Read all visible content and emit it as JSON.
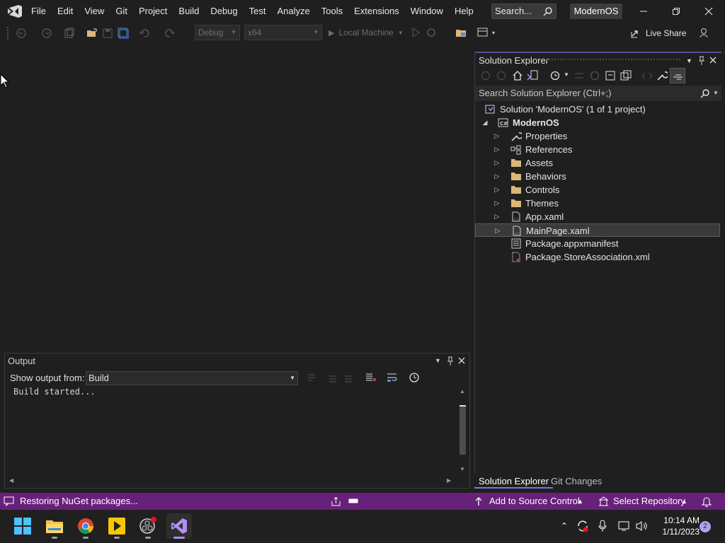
{
  "menu": [
    "File",
    "Edit",
    "View",
    "Git",
    "Project",
    "Build",
    "Debug",
    "Test",
    "Analyze",
    "Tools",
    "Extensions",
    "Window",
    "Help"
  ],
  "search": {
    "placeholder": "Search..."
  },
  "project_name": "ModernOS",
  "toolbar": {
    "config": "Debug",
    "platform": "x64",
    "run_target": "Local Machine",
    "live_share": "Live Share"
  },
  "output": {
    "title": "Output",
    "show_from_label": "Show output from:",
    "source": "Build",
    "text": "Build started..."
  },
  "solution_explorer": {
    "title": "Solution Explorer",
    "search_placeholder": "Search Solution Explorer (Ctrl+;)",
    "solution": "Solution 'ModernOS' (1 of 1 project)",
    "project": "ModernOS",
    "items": [
      {
        "label": "Properties",
        "icon": "wrench-icon"
      },
      {
        "label": "References",
        "icon": "references-icon"
      },
      {
        "label": "Assets",
        "icon": "folder-icon"
      },
      {
        "label": "Behaviors",
        "icon": "folder-icon"
      },
      {
        "label": "Controls",
        "icon": "folder-icon"
      },
      {
        "label": "Themes",
        "icon": "folder-icon"
      },
      {
        "label": "App.xaml",
        "icon": "xaml-file-icon"
      },
      {
        "label": "MainPage.xaml",
        "icon": "xaml-file-icon",
        "selected": true
      },
      {
        "label": "Package.appxmanifest",
        "icon": "manifest-icon"
      },
      {
        "label": "Package.StoreAssociation.xml",
        "icon": "xml-file-icon"
      }
    ],
    "tabs": [
      "Solution Explorer",
      "Git Changes"
    ]
  },
  "status": {
    "message": "Restoring NuGet packages...",
    "source_control": "Add to Source Control",
    "repository": "Select Repository"
  },
  "clock": {
    "time": "10:14 AM",
    "date": "1/11/2023"
  },
  "notifications": "2",
  "colors": {
    "accent": "#68217a",
    "vs_purple": "#5b4ba0",
    "folder": "#dcb67a"
  }
}
